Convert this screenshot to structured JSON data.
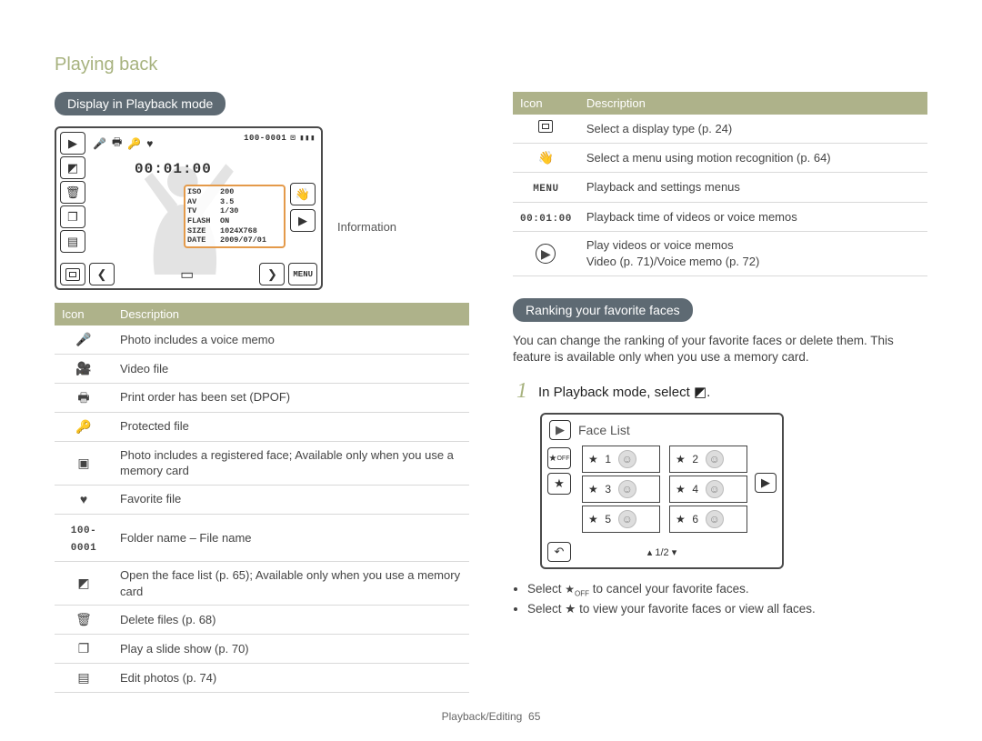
{
  "page_title": "Playing back",
  "left": {
    "section_heading": "Display in Playback mode",
    "lcd": {
      "time": "00:01:00",
      "file_counter": "100-0001",
      "info": {
        "iso_k": "ISO",
        "iso_v": "200",
        "av_k": "AV",
        "av_v": "3.5",
        "tv_k": "TV",
        "tv_v": "1/30",
        "flash_k": "FLASH",
        "flash_v": "ON",
        "size_k": "SIZE",
        "size_v": "1024X768",
        "date_k": "DATE",
        "date_v": "2009/07/01"
      },
      "callout": "Information",
      "menu_label": "MENU"
    },
    "table_header_icon": "Icon",
    "table_header_desc": "Description",
    "rows": [
      {
        "icon": "mic-icon",
        "glyph": "🎤",
        "desc": "Photo includes a voice memo"
      },
      {
        "icon": "video-icon",
        "glyph": "🎥",
        "desc": "Video file"
      },
      {
        "icon": "print-icon",
        "glyph": "🖶",
        "desc": "Print order has been set (DPOF)"
      },
      {
        "icon": "lock-icon",
        "glyph": "🔑",
        "desc": "Protected file"
      },
      {
        "icon": "face-reg-icon",
        "glyph": "▣",
        "desc": "Photo includes a registered face; Available only when you use a memory card"
      },
      {
        "icon": "favorite-icon",
        "glyph": "♥",
        "desc": "Favorite file"
      },
      {
        "icon": "filename-text",
        "glyph": "100-0001",
        "mono": true,
        "desc": "Folder name – File name"
      },
      {
        "icon": "face-list-icon",
        "glyph": "◩",
        "desc": "Open the face list (p. 65); Available only when you use a memory card"
      },
      {
        "icon": "trash-icon",
        "glyph": "🗑",
        "desc": "Delete files (p. 68)"
      },
      {
        "icon": "slideshow-icon",
        "glyph": "❐",
        "desc": "Play a slide show (p. 70)"
      },
      {
        "icon": "edit-icon",
        "glyph": "▤",
        "desc": "Edit photos (p. 74)"
      }
    ]
  },
  "right": {
    "table_header_icon": "Icon",
    "table_header_desc": "Description",
    "rows": [
      {
        "icon": "display-type-icon",
        "glyph": "▣",
        "desc": "Select a display type (p. 24)"
      },
      {
        "icon": "motion-icon",
        "glyph": "👋",
        "desc": "Select a menu using motion recognition (p. 64)"
      },
      {
        "icon": "menu-text",
        "glyph": "MENU",
        "mono": true,
        "desc": "Playback and settings menus"
      },
      {
        "icon": "playtime-text",
        "glyph": "00:01:00",
        "mono": true,
        "desc": "Playback time of videos or voice memos"
      },
      {
        "icon": "play-icon",
        "glyph": "▶",
        "desc": "Play videos or voice memos\nVideo (p. 71)/Voice memo (p. 72)"
      }
    ],
    "ranking_heading": "Ranking your favorite faces",
    "ranking_body": "You can change the ranking of your favorite faces or delete them. This feature is available only when you use a memory card.",
    "step1_num": "1",
    "step1_text": "In Playback mode, select",
    "face_lcd": {
      "title": "Face List",
      "ranks": [
        "1",
        "2",
        "3",
        "4",
        "5",
        "6"
      ],
      "pager": "1/2"
    },
    "bullets": [
      "Select      to cancel your favorite faces.",
      "Select ★ to view your favorite faces or view all faces."
    ]
  },
  "footer": {
    "section": "Playback/Editing",
    "page": "65"
  }
}
